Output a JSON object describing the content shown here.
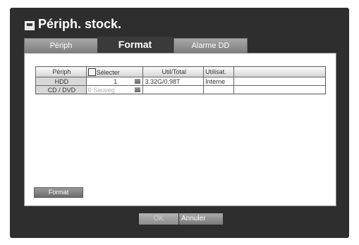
{
  "window": {
    "title": "Périph. stock."
  },
  "tabs": [
    {
      "label": "Périph",
      "active": false
    },
    {
      "label": "Format",
      "active": true
    },
    {
      "label": "Alarme DD",
      "active": false
    }
  ],
  "table": {
    "headers": {
      "periph": "Périph",
      "select": "Sélecter",
      "util_total": "Util/Total",
      "utilis": "Utilisat."
    },
    "rows": [
      {
        "periph": "HDD",
        "select": "1",
        "util_total": "3.32G/0.98T",
        "utilis": "Interne"
      },
      {
        "periph": "CD / DVD",
        "select": "0",
        "select_extra": "Sauveg",
        "util_total": "",
        "utilis": ""
      }
    ]
  },
  "buttons": {
    "format": "Format",
    "ok": "OK",
    "cancel": "Annuler"
  }
}
